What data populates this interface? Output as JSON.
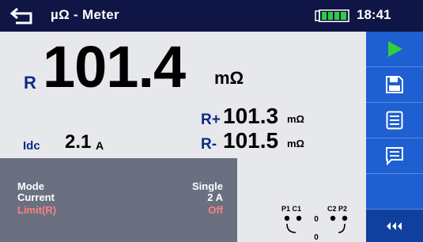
{
  "header": {
    "title": "µΩ - Meter",
    "time": "18:41",
    "back_icon": "back-arrow-icon",
    "battery_icon": "battery-full-icon",
    "battery_color": "#2ecc40"
  },
  "result": {
    "symbol": "R",
    "value": "101.4",
    "unit": "mΩ"
  },
  "sub_results": {
    "r_plus": {
      "symbol": "R+",
      "value": "101.3",
      "unit": "mΩ"
    },
    "r_minus": {
      "symbol": "R-",
      "value": "101.5",
      "unit": "mΩ"
    }
  },
  "idc": {
    "label": "Idc",
    "value": "2.1",
    "unit": "A"
  },
  "params": [
    {
      "key": "Mode",
      "value": "Single"
    },
    {
      "key": "Current",
      "value": "2 A"
    },
    {
      "key": "Limit(R)",
      "value": "Off"
    }
  ],
  "connection": {
    "left_label": "P1 C1",
    "right_label": "C2 P2",
    "mid_value": "0",
    "bottom_value": "0"
  },
  "sidebar": {
    "buttons": [
      {
        "name": "start-button",
        "icon": "play-icon"
      },
      {
        "name": "save-button",
        "icon": "floppy-disk-icon"
      },
      {
        "name": "memory-list-button",
        "icon": "list-icon"
      },
      {
        "name": "comment-button",
        "icon": "comment-icon"
      },
      {
        "name": "more-button",
        "icon": "triple-left-arrow-icon"
      }
    ]
  },
  "colors": {
    "titlebar": "#0f1544",
    "sidebar": "#1e5fd1",
    "accent_label": "#0d2a8a",
    "play": "#2fd13a",
    "limit_alert": "#ff7f7f",
    "param_panel": "#6a7080"
  }
}
